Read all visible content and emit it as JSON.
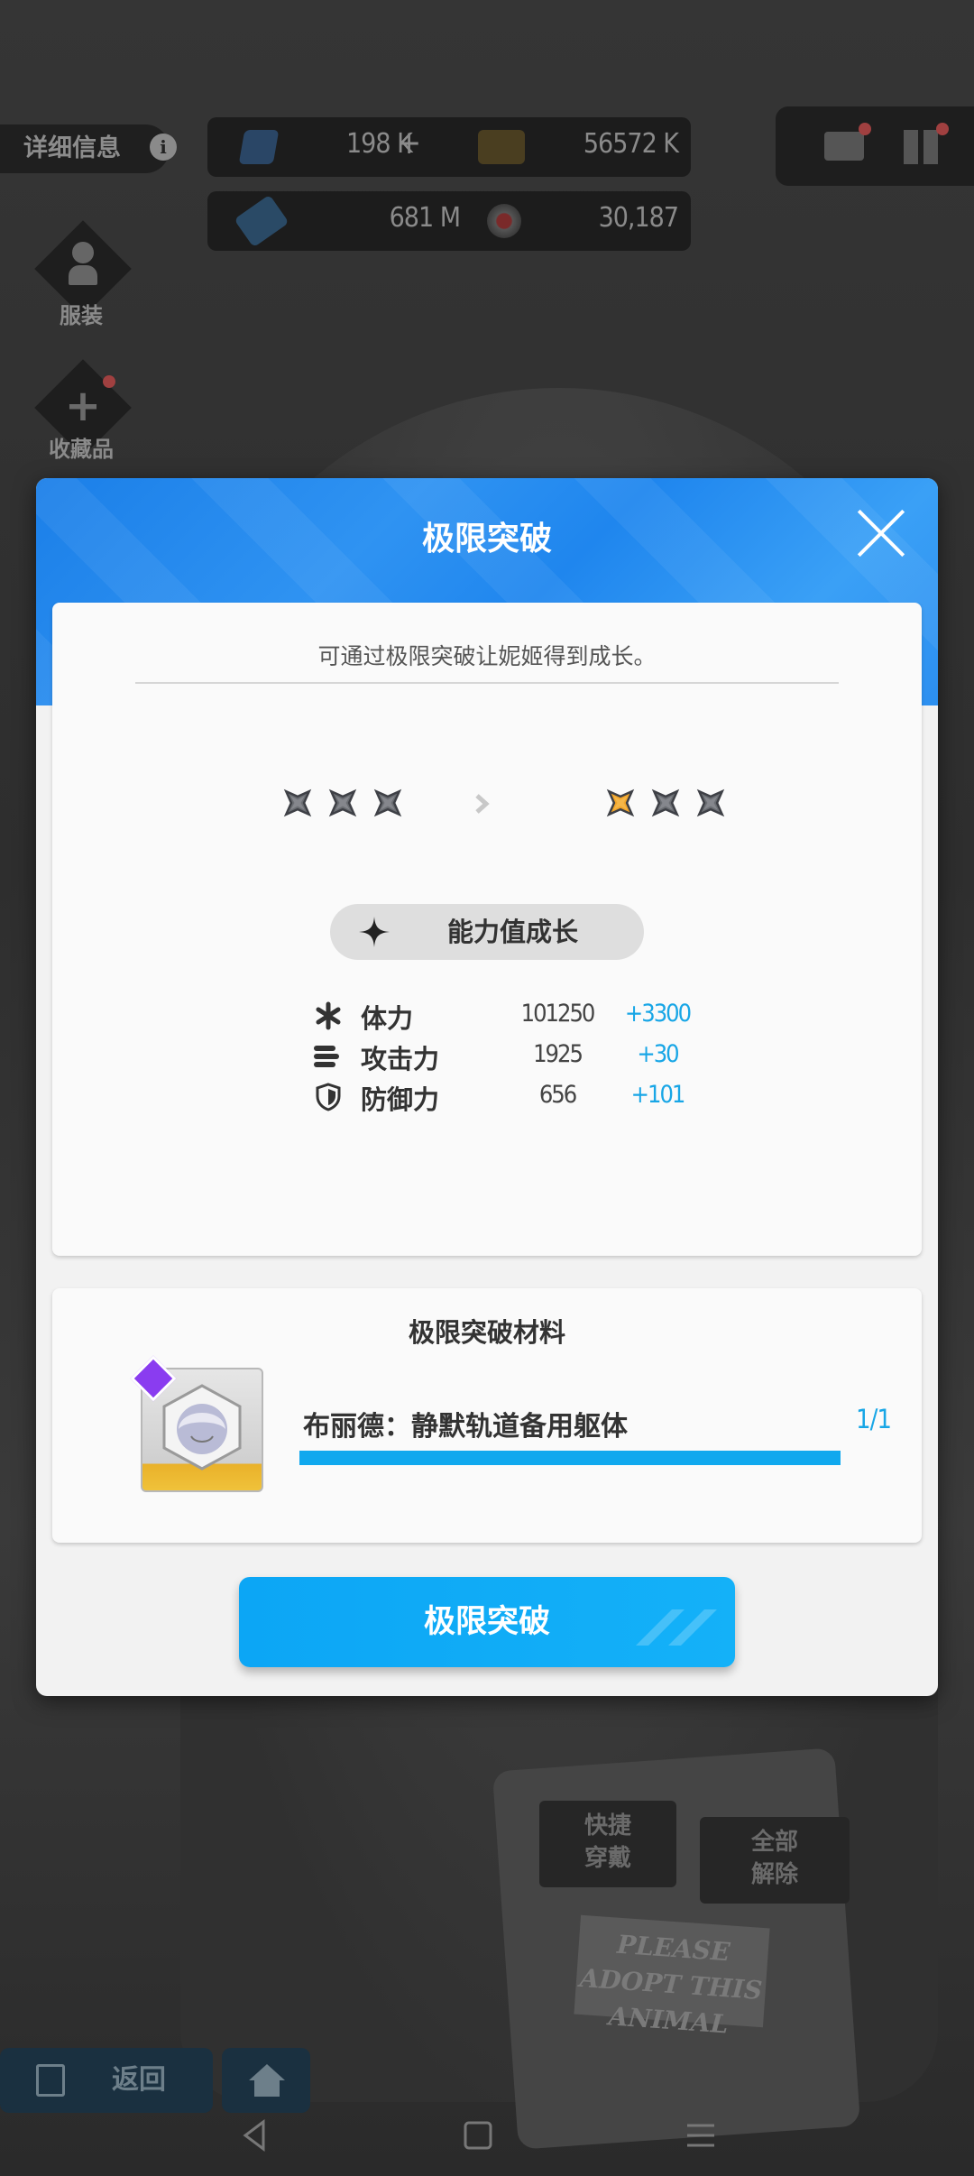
{
  "background": {
    "detail_tab": "详细信息",
    "info_icon": "i",
    "resources": [
      {
        "icon": "ticket-icon",
        "value": "198 K"
      },
      {
        "icon": "credit-card-icon",
        "value": "56572 K"
      },
      {
        "icon": "battery-icon",
        "value": "681 M"
      },
      {
        "icon": "core-icon",
        "value": "30,187"
      }
    ],
    "side_buttons": [
      {
        "icon": "person-icon",
        "label": "服装"
      },
      {
        "icon": "plus-icon",
        "label": "收藏品"
      }
    ],
    "quick_equip": "快捷\n穿戴",
    "unequip_all": "全部\n解除",
    "back_label": "返回",
    "sign_text": "PLEASE ADOPT THIS ANIMAL"
  },
  "modal": {
    "title": "极限突破",
    "description": "可通过极限突破让妮姬得到成长。",
    "stars_before": {
      "filled": 0,
      "total": 3
    },
    "stars_after": {
      "filled": 1,
      "total": 3
    },
    "growth_title": "能力值成长",
    "stats": [
      {
        "icon": "hp-asterisk-icon",
        "name": "体力",
        "value": "101250",
        "increase": "+3300"
      },
      {
        "icon": "attack-bullets-icon",
        "name": "攻击力",
        "value": "1925",
        "increase": "+30"
      },
      {
        "icon": "defense-shield-icon",
        "name": "防御力",
        "value": "656",
        "increase": "+101"
      }
    ],
    "materials": {
      "title": "极限突破材料",
      "item_name": "布丽德：静默轨道备用躯体",
      "count": "1/1",
      "progress": 1.0
    },
    "confirm_label": "极限突破"
  },
  "colors": {
    "accent": "#10a8ee",
    "header_blue": "#1f86ee",
    "star_gold": "#f2a52a",
    "star_gray": "#6b6e73"
  }
}
